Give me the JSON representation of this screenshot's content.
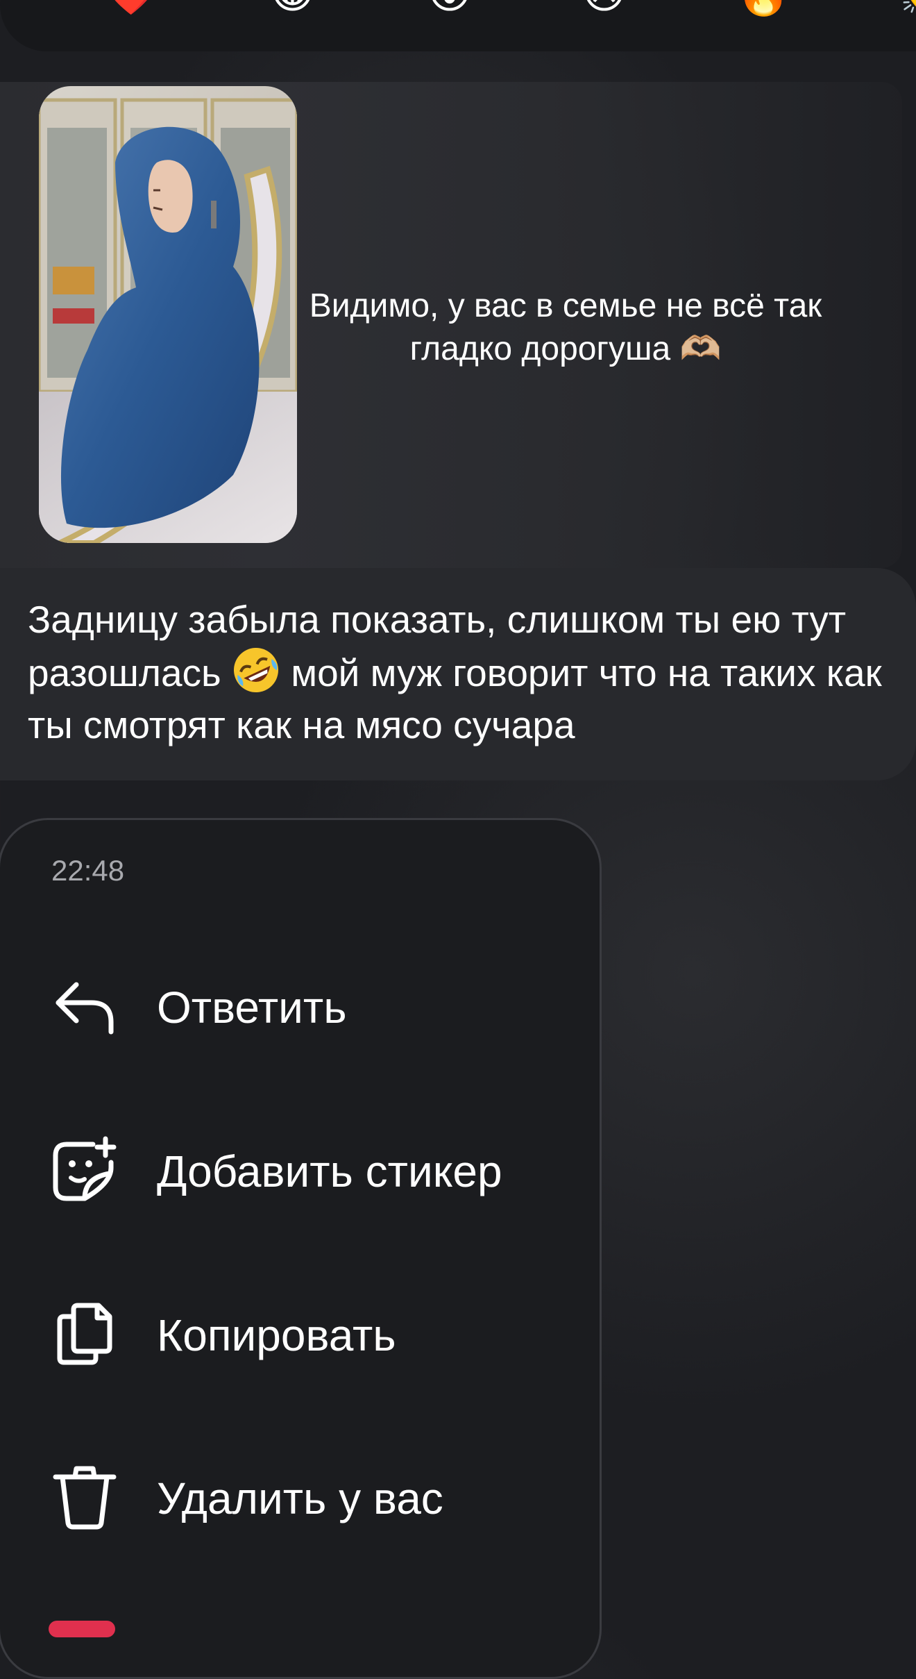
{
  "reactions": {
    "items": [
      {
        "name": "heart-emoji",
        "glyph": "❤️"
      },
      {
        "name": "laugh-emoji",
        "glyph": "😂"
      },
      {
        "name": "wow-emoji",
        "glyph": "😮"
      },
      {
        "name": "sad-emoji",
        "glyph": "😢"
      },
      {
        "name": "fire-emoji",
        "glyph": "🔥"
      },
      {
        "name": "clap-emoji",
        "glyph": "👏"
      }
    ]
  },
  "story_reply": {
    "text": "Видимо, у вас в семье не всё так гладко дорогуша 🫶🏼"
  },
  "message": {
    "text_before_emoji": "Задницу забыла показать, слишком ты ею тут разошлась ",
    "emoji_icon": "rolling-on-floor-laughing-emoji",
    "text_after_emoji": " мой муж говорит что на таких как ты смотрят как на мясо сучара"
  },
  "context_menu": {
    "timestamp": "22:48",
    "items": [
      {
        "label": "Ответить",
        "icon": "reply-icon"
      },
      {
        "label": "Добавить стикер",
        "icon": "add-sticker-icon"
      },
      {
        "label": "Копировать",
        "icon": "copy-icon"
      },
      {
        "label": "Удалить у вас",
        "icon": "trash-icon"
      }
    ]
  },
  "colors": {
    "background": "#1d1e22",
    "bubble": "#28292d",
    "menu": "#1b1c1f",
    "timestamp": "#a8a9ae",
    "danger": "#e0304e"
  }
}
